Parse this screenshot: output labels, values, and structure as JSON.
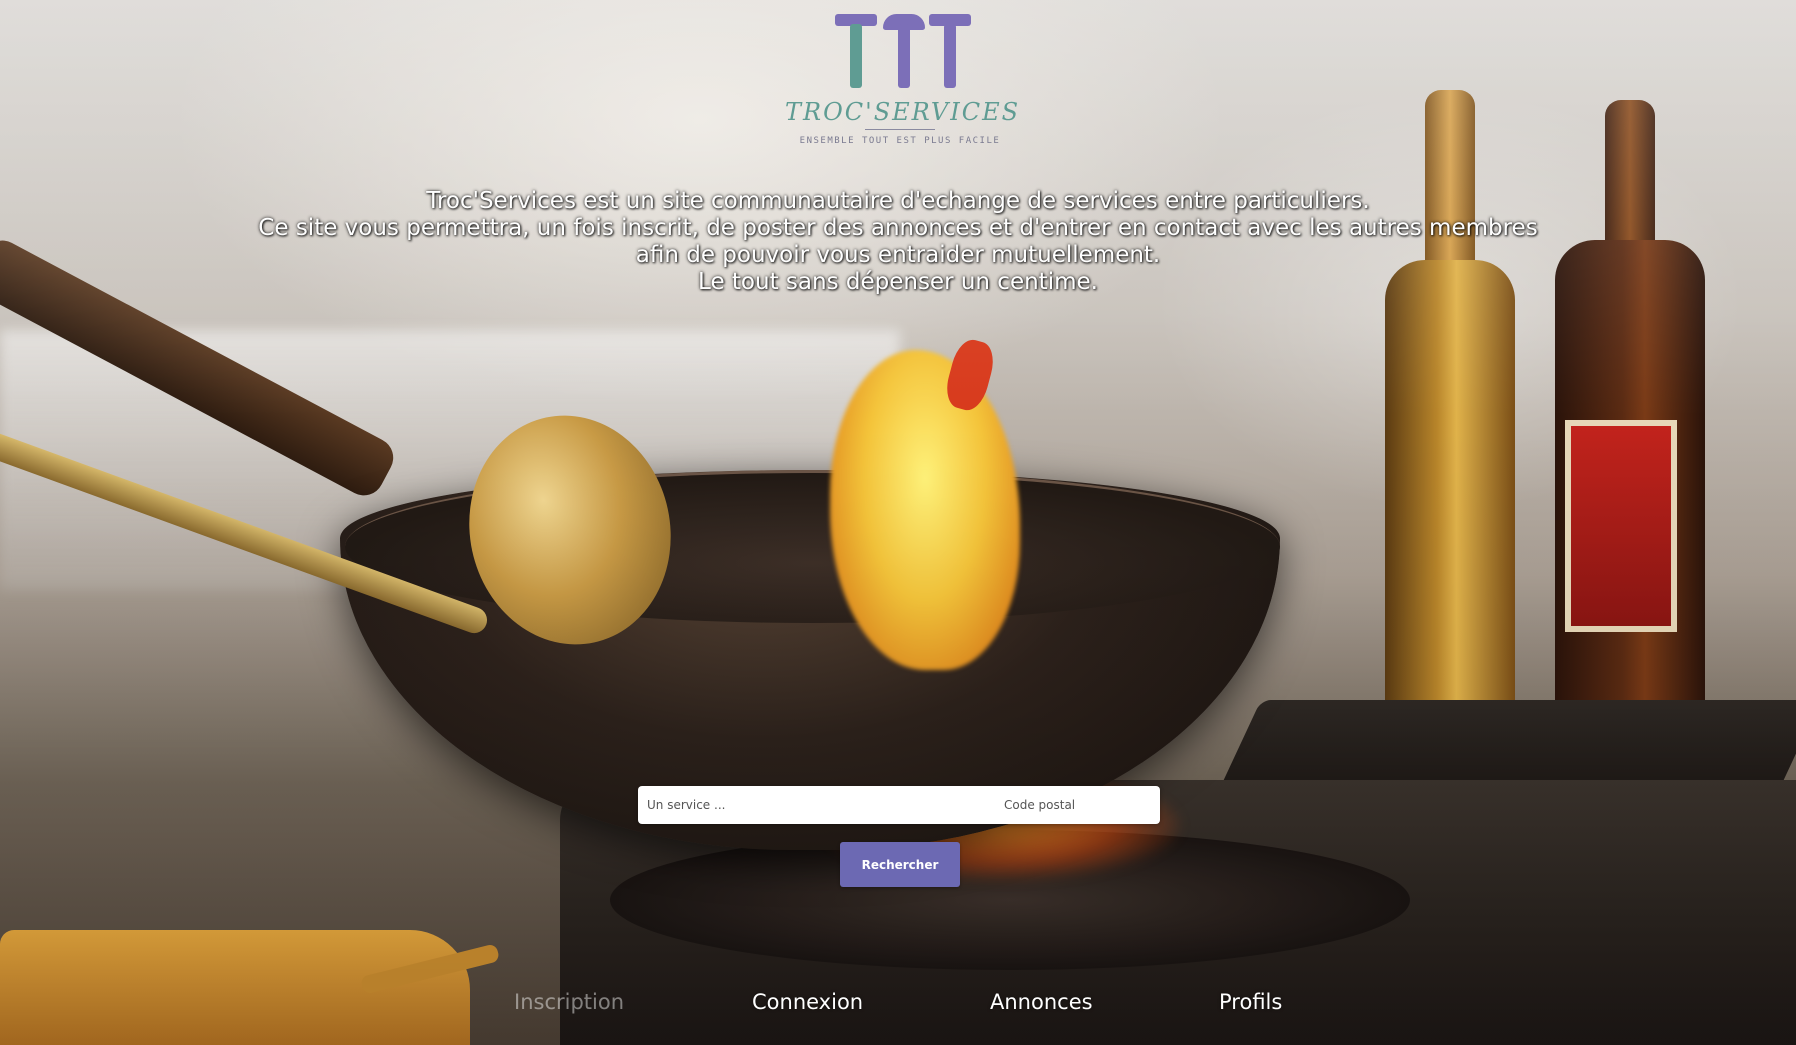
{
  "logo": {
    "name": "TROC'SERVICES",
    "tagline": "ENSEMBLE TOUT EST PLUS FACILE"
  },
  "intro": {
    "lines": [
      "Troc'Services est un site communautaire d'echange de services entre particuliers.",
      "Ce site vous permettra, un fois inscrit, de poster des annonces et d'entrer en contact avec les autres membres",
      "afin de pouvoir vous entraider mutuellement.",
      "Le tout sans dépenser un centime."
    ]
  },
  "search": {
    "service_placeholder": "Un service ...",
    "postal_placeholder": "Code postal",
    "button_label": "Rechercher"
  },
  "nav": {
    "items": [
      {
        "label": "Inscription",
        "active": false
      },
      {
        "label": "Connexion",
        "active": true
      },
      {
        "label": "Annonces",
        "active": true
      },
      {
        "label": "Profils",
        "active": true
      }
    ]
  },
  "colors": {
    "button_bg": "#6c69b3",
    "logo_purple": "#7c6fb8",
    "logo_teal": "#5f9c93"
  }
}
